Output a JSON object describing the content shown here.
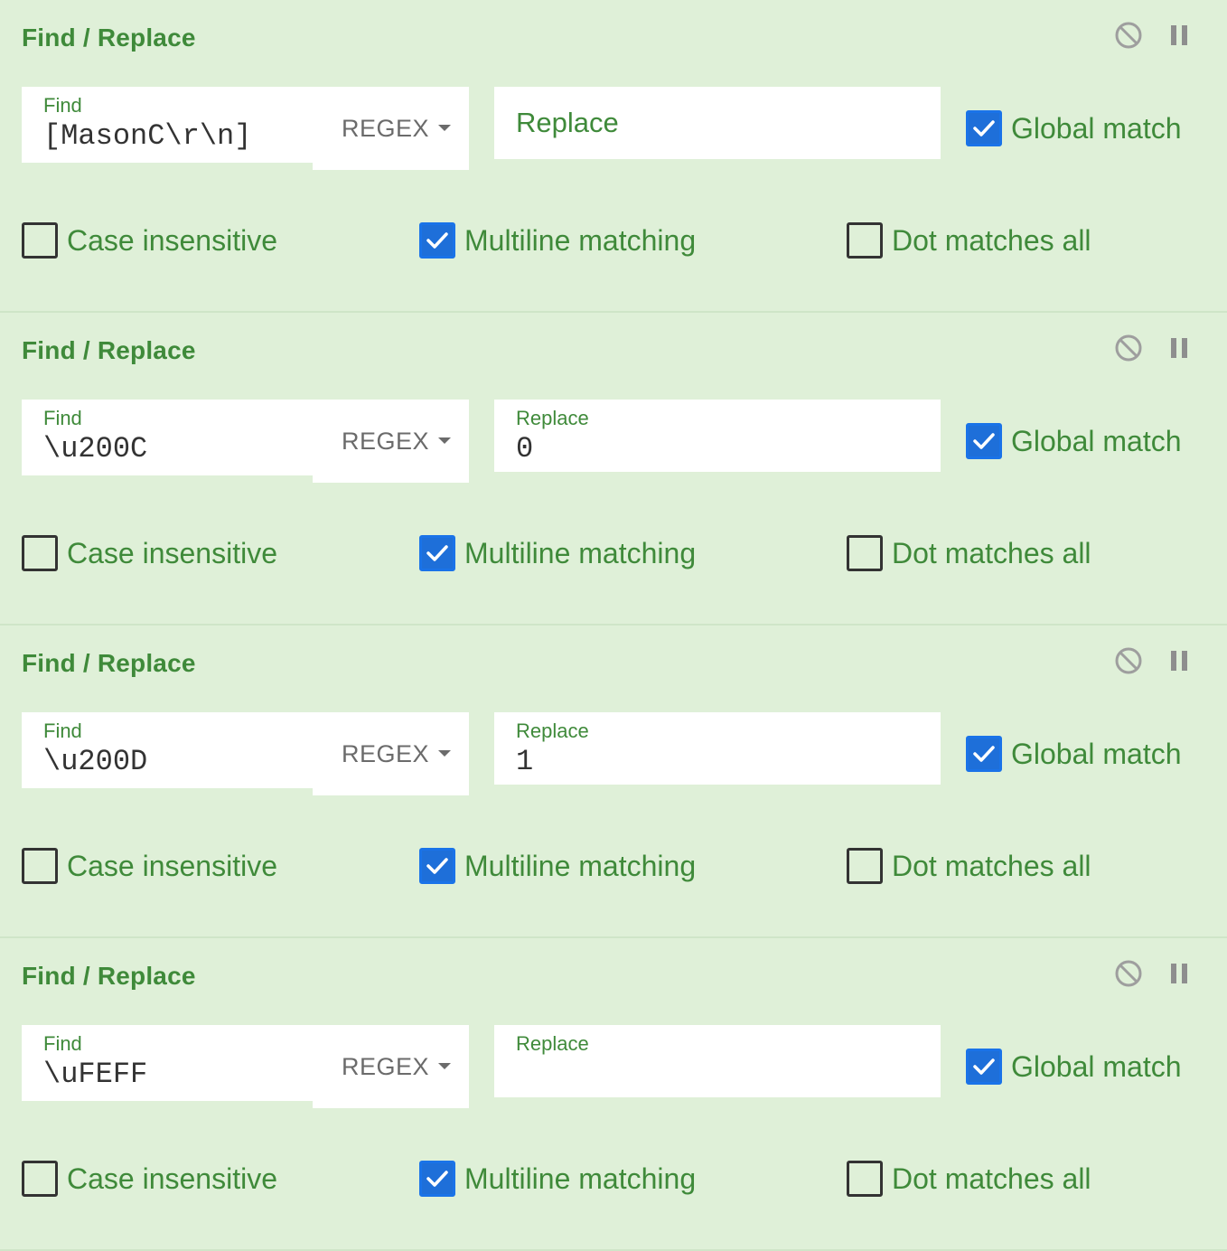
{
  "operations": [
    {
      "title": "Find / Replace",
      "find_label": "Find",
      "find_value": "[MasonC\\r\\n]",
      "mode": "REGEX",
      "replace_label": "",
      "replace_placeholder": "Replace",
      "replace_value": "",
      "global_match": {
        "label": "Global match",
        "checked": true
      },
      "case_insensitive": {
        "label": "Case insensitive",
        "checked": false
      },
      "multiline": {
        "label": "Multiline matching",
        "checked": true
      },
      "dot_all": {
        "label": "Dot matches all",
        "checked": false
      }
    },
    {
      "title": "Find / Replace",
      "find_label": "Find",
      "find_value": "\\u200C",
      "mode": "REGEX",
      "replace_label": "Replace",
      "replace_placeholder": "",
      "replace_value": "0",
      "global_match": {
        "label": "Global match",
        "checked": true
      },
      "case_insensitive": {
        "label": "Case insensitive",
        "checked": false
      },
      "multiline": {
        "label": "Multiline matching",
        "checked": true
      },
      "dot_all": {
        "label": "Dot matches all",
        "checked": false
      }
    },
    {
      "title": "Find / Replace",
      "find_label": "Find",
      "find_value": "\\u200D",
      "mode": "REGEX",
      "replace_label": "Replace",
      "replace_placeholder": "",
      "replace_value": "1",
      "global_match": {
        "label": "Global match",
        "checked": true
      },
      "case_insensitive": {
        "label": "Case insensitive",
        "checked": false
      },
      "multiline": {
        "label": "Multiline matching",
        "checked": true
      },
      "dot_all": {
        "label": "Dot matches all",
        "checked": false
      }
    },
    {
      "title": "Find / Replace",
      "find_label": "Find",
      "find_value": "\\uFEFF",
      "mode": "REGEX",
      "replace_label": "Replace",
      "replace_placeholder": "",
      "replace_value": "",
      "global_match": {
        "label": "Global match",
        "checked": true
      },
      "case_insensitive": {
        "label": "Case insensitive",
        "checked": false
      },
      "multiline": {
        "label": "Multiline matching",
        "checked": true
      },
      "dot_all": {
        "label": "Dot matches all",
        "checked": false
      }
    }
  ],
  "icons": {
    "disable": "disable-icon",
    "pause": "pause-icon"
  },
  "colors": {
    "background": "#dff0d8",
    "accent_text": "#3f8a3a",
    "checkbox_checked": "#1e6fd9"
  }
}
